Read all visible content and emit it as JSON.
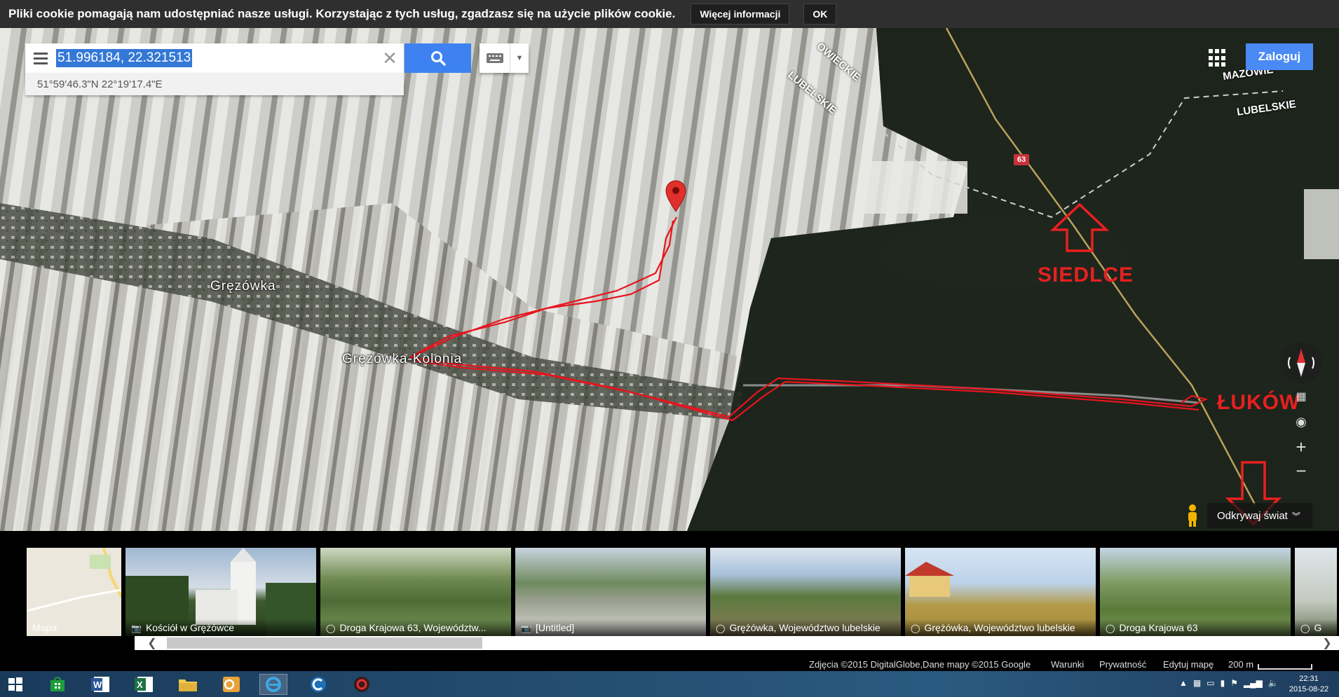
{
  "cookie_bar": {
    "text": "Pliki cookie pomagają nam udostępniać nasze usługi. Korzystając z tych usług, zgadzasz się na użycie plików cookie.",
    "more_info_label": "Więcej informacji",
    "ok_label": "OK"
  },
  "search": {
    "value": "51.996184, 22.321513",
    "coordinates_dms": "51°59'46.3\"N 22°19'17.4\"E"
  },
  "header": {
    "login_label": "Zaloguj"
  },
  "map": {
    "labels": {
      "town1": "Gręzówka",
      "town2": "Gręzówka-Kolonia",
      "region_lubelskie_top": "LUBELSKIE",
      "region_lubelskie_right": "LUBELSKIE",
      "region_mazowieckie_top": "OWIECKIE",
      "region_mazowieckie_right": "MAZOWIE",
      "road_number": "63"
    },
    "annotations": {
      "north": "SIEDLCE",
      "south": "ŁUKÓW"
    },
    "colors": {
      "track": "#e8141e",
      "annotation": "#e82020",
      "login": "#4a8af4",
      "search_button": "#3d82f0"
    }
  },
  "controls": {
    "zoom_in": "+",
    "zoom_out": "−",
    "explore_label": "Odkrywaj świat"
  },
  "photos": [
    {
      "caption": "Mapa",
      "type": "map"
    },
    {
      "caption": "Kościół w Grężówce",
      "type": "photo"
    },
    {
      "caption": "Droga Krajowa 63, Województw...",
      "type": "streetview"
    },
    {
      "caption": "[Untitled]",
      "type": "photo"
    },
    {
      "caption": "Grężówka, Województwo lubelskie",
      "type": "streetview"
    },
    {
      "caption": "Grężówka, Województwo lubelskie",
      "type": "streetview"
    },
    {
      "caption": "Droga Krajowa 63",
      "type": "streetview"
    },
    {
      "caption": "G",
      "type": "streetview"
    }
  ],
  "attribution": {
    "imagery": "Zdjęcia ©2015 DigitalGlobe,Dane mapy ©2015 Google",
    "terms": "Warunki",
    "privacy": "Prywatność",
    "edit_map": "Edytuj mapę",
    "scale": "200 m"
  },
  "taskbar": {
    "time": "22:31",
    "date": "2015-08-22"
  }
}
